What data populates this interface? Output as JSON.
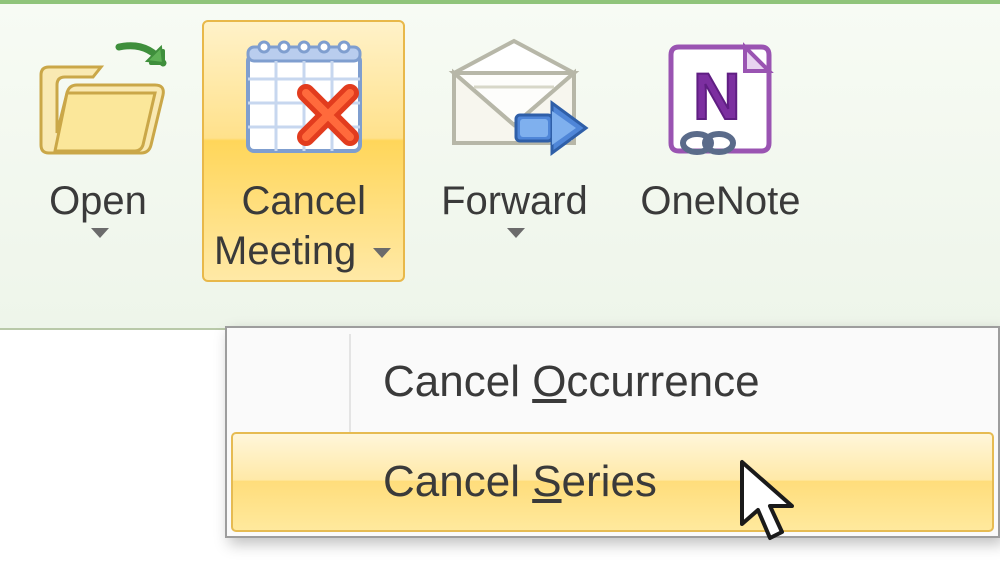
{
  "ribbon": {
    "buttons": {
      "open": {
        "label_line1": "Open",
        "has_dropdown": true
      },
      "cancel": {
        "label_line1": "Cancel",
        "label_line2": "Meeting",
        "has_dropdown": true,
        "selected": true
      },
      "forward": {
        "label_line1": "Forward",
        "has_dropdown": true
      },
      "onenote": {
        "label_line1": "OneNote",
        "has_dropdown": false
      }
    }
  },
  "dropdown": {
    "items": [
      {
        "label_pre": "Cancel ",
        "ul": "O",
        "label_post": "ccurrence",
        "hover": false
      },
      {
        "label_pre": "Cancel ",
        "ul": "S",
        "label_post": "eries",
        "hover": true
      }
    ]
  }
}
